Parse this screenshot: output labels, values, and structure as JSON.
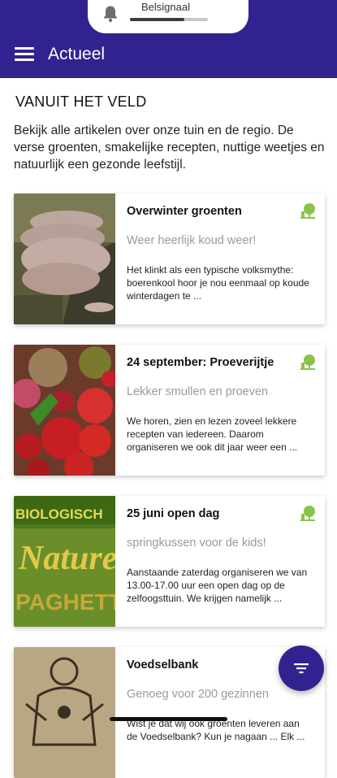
{
  "status": {
    "signal_label": "Belsignaal",
    "signal_level": 0.7
  },
  "appbar": {
    "title": "Actueel"
  },
  "section": {
    "title": "VANUIT HET VELD",
    "description": "Bekijk alle artikelen over onze tuin en de regio. De verse groenten, smakelijke recepten, nuttige weetjes en natuurlijk een gezonde leefstijl."
  },
  "articles": [
    {
      "title": "Overwinter groenten",
      "subtitle": "Weer heerlijk koud weer!",
      "excerpt": "Het klinkt als een typische volksmythe: boerenkool hoor je nou eenmaal op koude winterdagen te ..."
    },
    {
      "title": "24 september: Proeverijtje",
      "subtitle": "Lekker smullen en proeven",
      "excerpt": "We horen, zien en lezen zoveel lekkere recepten van iedereen. Daarom organiseren we ook dit jaar weer een ..."
    },
    {
      "title": "25 juni open dag",
      "subtitle": "springkussen voor de kids!",
      "excerpt": "Aanstaande zaterdag organiseren we van 13.00-17.00 uur een open dag op de zelfoogsttuin. We krijgen namelijk ..."
    },
    {
      "title": "Voedselbank",
      "subtitle": "Genoeg voor 200 gezinnen",
      "excerpt": "Wist je dat wij ook groenten leveren aan de Voedselbank? Kun je nagaan ... Elk ..."
    }
  ],
  "image_texts": {
    "card3": "BIOLOGISCH Naturel SPAGHETTI"
  },
  "icons": {
    "menu": "menu-icon",
    "bell": "bell-icon",
    "category": "leaf-icon",
    "filter": "filter-icon"
  },
  "colors": {
    "primary": "#31238f",
    "accent": "#8bc34a"
  }
}
